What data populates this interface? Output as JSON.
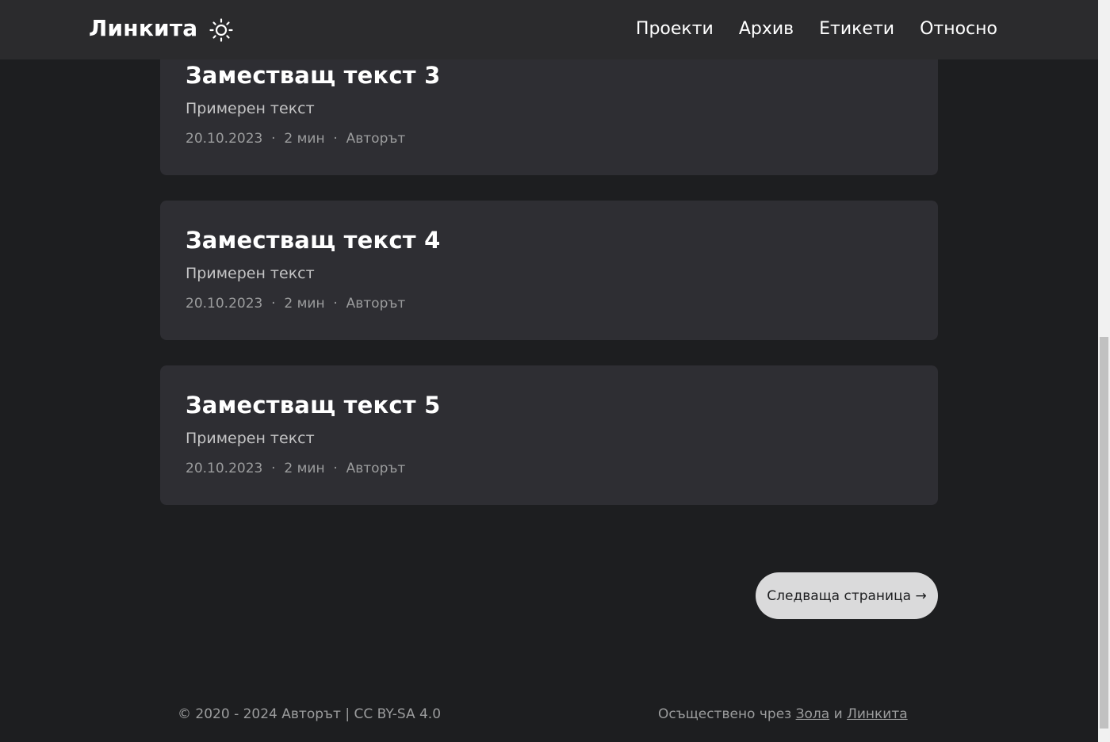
{
  "header": {
    "logo": "Линкита",
    "theme_icon": "sun-icon",
    "nav": [
      "Проекти",
      "Архив",
      "Етикети",
      "Относно"
    ]
  },
  "posts": [
    {
      "title": "Заместващ текст 3",
      "summary": "Примерен текст",
      "date": "20.10.2023",
      "reading_time": "2 мин",
      "author": "Авторът"
    },
    {
      "title": "Заместващ текст 4",
      "summary": "Примерен текст",
      "date": "20.10.2023",
      "reading_time": "2 мин",
      "author": "Авторът"
    },
    {
      "title": "Заместващ текст 5",
      "summary": "Примерен текст",
      "date": "20.10.2023",
      "reading_time": "2 мин",
      "author": "Авторът"
    }
  ],
  "pagination": {
    "next_label": "Следваща страница →"
  },
  "footer": {
    "copyright": "© 2020 - 2024 Авторът | CC BY-SA 4.0",
    "powered_prefix": "Осъществено чрез ",
    "powered_link1": "Зола",
    "powered_and": " и ",
    "powered_link2": "Линкита"
  },
  "colors": {
    "background": "#1d1e20",
    "header": "#2b2b2d",
    "card": "#2e2e33",
    "button": "#dadadb"
  }
}
